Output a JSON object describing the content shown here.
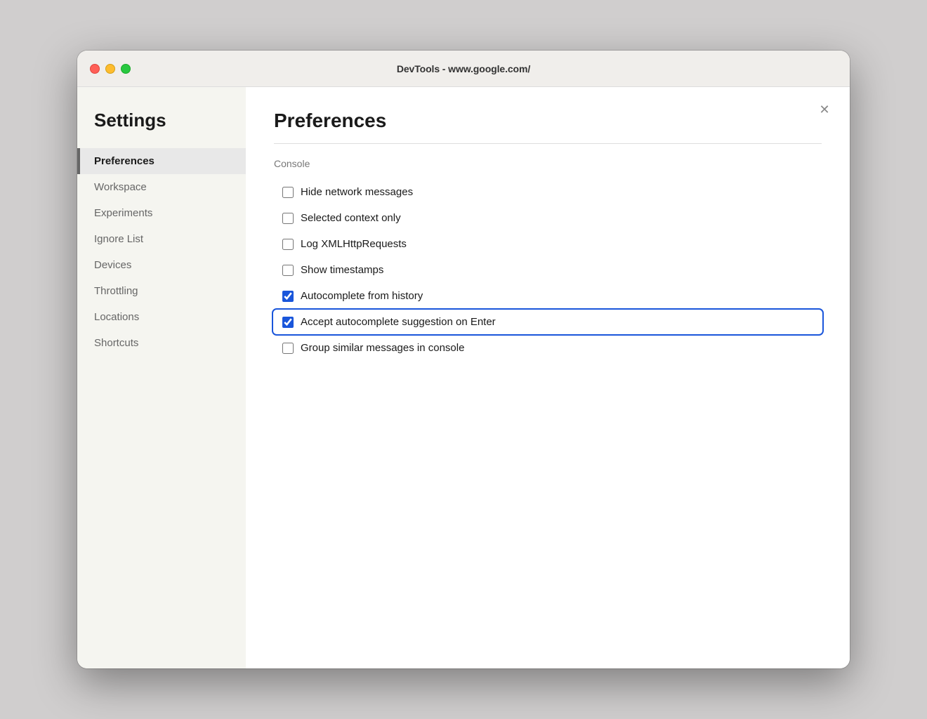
{
  "window": {
    "title": "DevTools - www.google.com/"
  },
  "sidebar": {
    "heading": "Settings",
    "items": [
      {
        "id": "preferences",
        "label": "Preferences",
        "active": true
      },
      {
        "id": "workspace",
        "label": "Workspace",
        "active": false
      },
      {
        "id": "experiments",
        "label": "Experiments",
        "active": false
      },
      {
        "id": "ignore-list",
        "label": "Ignore List",
        "active": false
      },
      {
        "id": "devices",
        "label": "Devices",
        "active": false
      },
      {
        "id": "throttling",
        "label": "Throttling",
        "active": false
      },
      {
        "id": "locations",
        "label": "Locations",
        "active": false
      },
      {
        "id": "shortcuts",
        "label": "Shortcuts",
        "active": false
      }
    ]
  },
  "main": {
    "section_title": "Preferences",
    "subsection_title": "Console",
    "checkboxes": [
      {
        "id": "hide-network",
        "label": "Hide network messages",
        "checked": false,
        "focused": false
      },
      {
        "id": "selected-context",
        "label": "Selected context only",
        "checked": false,
        "focused": false
      },
      {
        "id": "log-xml",
        "label": "Log XMLHttpRequests",
        "checked": false,
        "focused": false
      },
      {
        "id": "show-timestamps",
        "label": "Show timestamps",
        "checked": false,
        "focused": false
      },
      {
        "id": "autocomplete-history",
        "label": "Autocomplete from history",
        "checked": true,
        "focused": false
      },
      {
        "id": "autocomplete-enter",
        "label": "Accept autocomplete suggestion on Enter",
        "checked": true,
        "focused": true
      },
      {
        "id": "group-similar",
        "label": "Group similar messages in console",
        "checked": false,
        "focused": false
      }
    ]
  },
  "traffic_lights": {
    "close_color": "#ff5f57",
    "minimize_color": "#febc2e",
    "maximize_color": "#28c840"
  }
}
